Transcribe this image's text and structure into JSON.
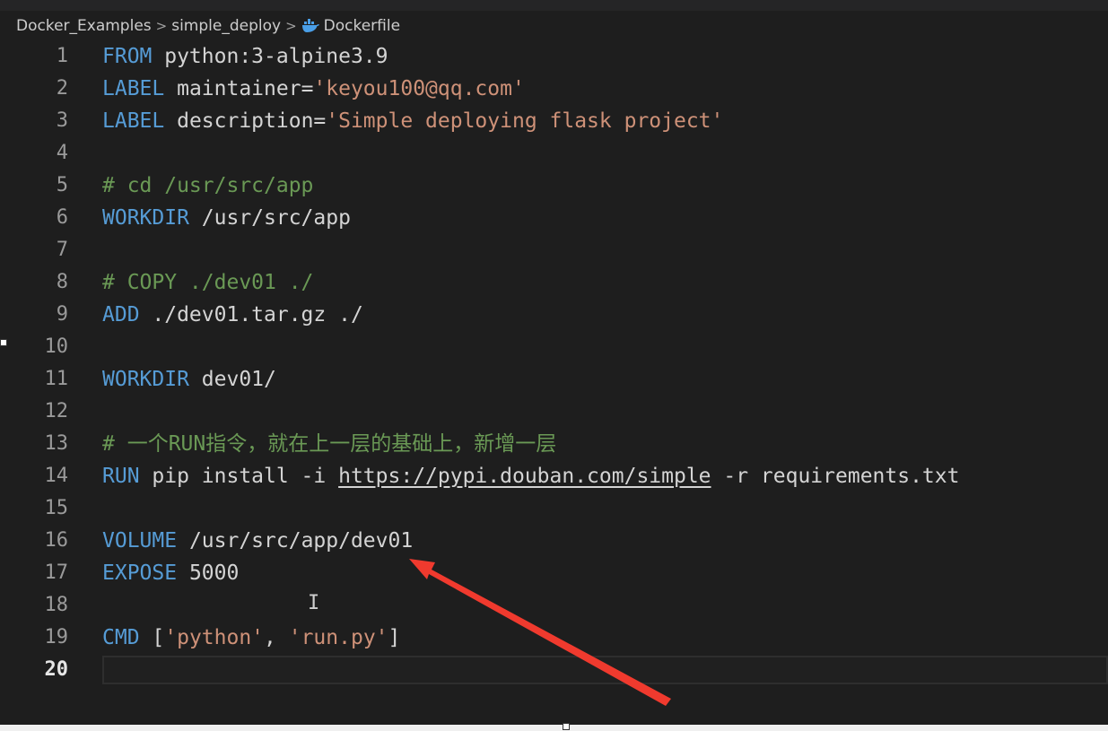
{
  "breadcrumb": {
    "items": [
      "Docker_Examples",
      "simple_deploy",
      "Dockerfile"
    ],
    "file_icon": "docker-whale-icon"
  },
  "editor": {
    "active_line": 20,
    "lines": [
      {
        "n": "1",
        "tokens": [
          {
            "t": "FROM",
            "c": "kw"
          },
          {
            "t": " python:3-alpine3.9",
            "c": "txt"
          }
        ]
      },
      {
        "n": "2",
        "tokens": [
          {
            "t": "LABEL",
            "c": "kw"
          },
          {
            "t": " maintainer=",
            "c": "txt"
          },
          {
            "t": "'keyou100@qq.com'",
            "c": "str"
          }
        ]
      },
      {
        "n": "3",
        "tokens": [
          {
            "t": "LABEL",
            "c": "kw"
          },
          {
            "t": " description=",
            "c": "txt"
          },
          {
            "t": "'Simple deploying flask project'",
            "c": "str"
          }
        ]
      },
      {
        "n": "4",
        "tokens": []
      },
      {
        "n": "5",
        "tokens": [
          {
            "t": "# cd /usr/src/app",
            "c": "cmt"
          }
        ]
      },
      {
        "n": "6",
        "tokens": [
          {
            "t": "WORKDIR",
            "c": "kw"
          },
          {
            "t": " /usr/src/app",
            "c": "txt"
          }
        ]
      },
      {
        "n": "7",
        "tokens": []
      },
      {
        "n": "8",
        "tokens": [
          {
            "t": "# COPY ./dev01 ./",
            "c": "cmt"
          }
        ]
      },
      {
        "n": "9",
        "tokens": [
          {
            "t": "ADD",
            "c": "kw"
          },
          {
            "t": " ./dev01.tar.gz ./",
            "c": "txt"
          }
        ]
      },
      {
        "n": "10",
        "tokens": []
      },
      {
        "n": "11",
        "tokens": [
          {
            "t": "WORKDIR",
            "c": "kw"
          },
          {
            "t": " dev01/",
            "c": "txt"
          }
        ]
      },
      {
        "n": "12",
        "tokens": []
      },
      {
        "n": "13",
        "tokens": [
          {
            "t": "# 一个RUN指令，就在上一层的基础上，新增一层",
            "c": "cmt"
          }
        ]
      },
      {
        "n": "14",
        "tokens": [
          {
            "t": "RUN",
            "c": "kw"
          },
          {
            "t": " pip install -i ",
            "c": "txt"
          },
          {
            "t": "https://pypi.douban.com/simple",
            "c": "link"
          },
          {
            "t": " -r requirements.txt",
            "c": "txt"
          }
        ]
      },
      {
        "n": "15",
        "tokens": []
      },
      {
        "n": "16",
        "tokens": [
          {
            "t": "VOLUME",
            "c": "kw"
          },
          {
            "t": " /usr/src/app/dev01",
            "c": "txt"
          }
        ]
      },
      {
        "n": "17",
        "tokens": [
          {
            "t": "EXPOSE",
            "c": "kw"
          },
          {
            "t": " 5000",
            "c": "txt"
          }
        ]
      },
      {
        "n": "18",
        "tokens": []
      },
      {
        "n": "19",
        "tokens": [
          {
            "t": "CMD",
            "c": "kw"
          },
          {
            "t": " [",
            "c": "txt"
          },
          {
            "t": "'python'",
            "c": "str"
          },
          {
            "t": ", ",
            "c": "txt"
          },
          {
            "t": "'run.py'",
            "c": "str"
          },
          {
            "t": "]",
            "c": "txt"
          }
        ]
      },
      {
        "n": "20",
        "tokens": []
      }
    ]
  },
  "annotation": {
    "arrow_color": "#f03a2e",
    "points_to": "VOLUME /usr/src/app/dev01"
  },
  "colors": {
    "background": "#1e1e1e",
    "keyword": "#569cd6",
    "string": "#ce9178",
    "comment": "#6a9955",
    "text": "#d4d4d4",
    "line_number": "#9a9a9a"
  }
}
